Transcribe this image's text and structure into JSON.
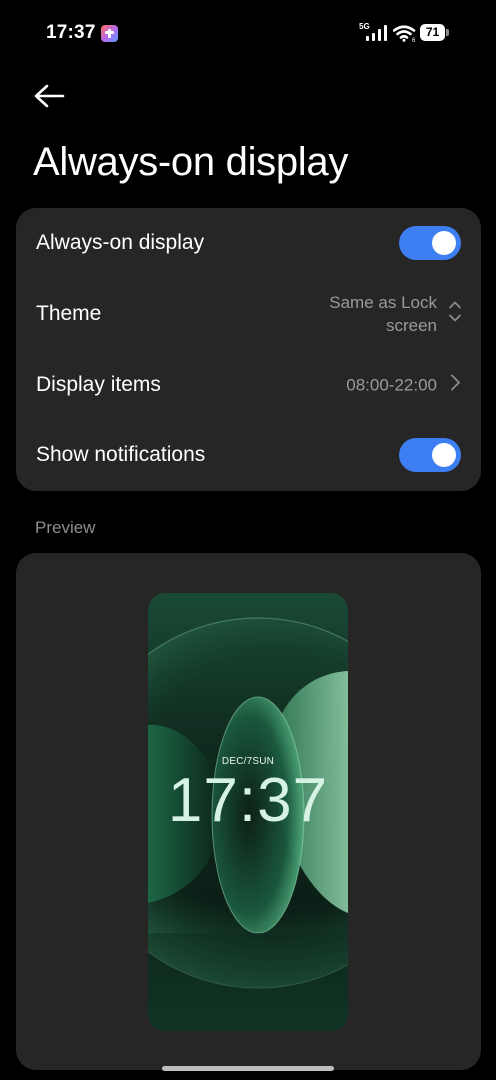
{
  "status_bar": {
    "time": "17:37",
    "network": "5G",
    "battery": "71",
    "app_icon": "app-notification-icon",
    "signal_icon": "cellular-signal-icon",
    "wifi_icon": "wifi-icon",
    "battery_icon": "battery-icon"
  },
  "header": {
    "back_icon": "back-arrow-icon",
    "title": "Always-on display"
  },
  "settings": {
    "always_on": {
      "label": "Always-on display",
      "enabled": true
    },
    "theme": {
      "label": "Theme",
      "value_line1": "Same as Lock",
      "value_line2": "screen",
      "icon": "up-down-chevron-icon"
    },
    "display_items": {
      "label": "Display items",
      "value": "08:00-22:00",
      "icon": "chevron-right-icon"
    },
    "show_notifications": {
      "label": "Show notifications",
      "enabled": true
    }
  },
  "preview": {
    "label": "Preview",
    "date": "DEC/7SUN",
    "time": "17:37"
  },
  "colors": {
    "accent": "#3d7ef2",
    "card_background": "#262626",
    "page_background": "#000000"
  }
}
